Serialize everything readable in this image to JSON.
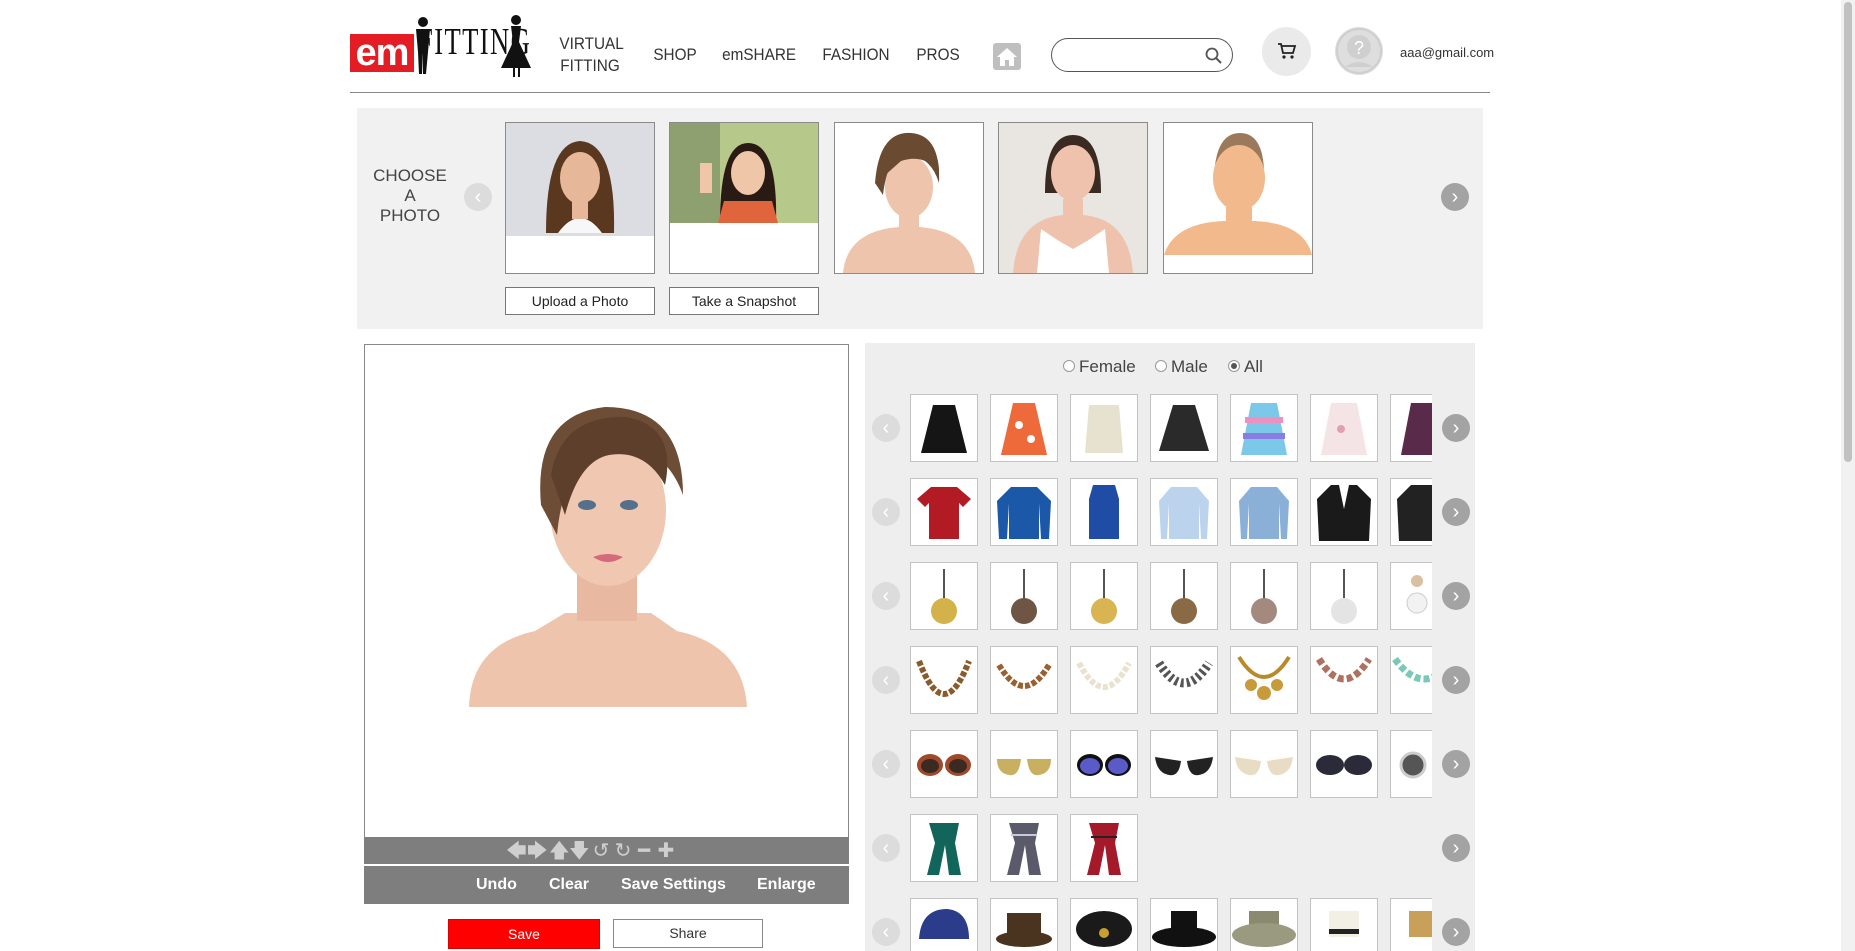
{
  "header": {
    "logo_em": "em",
    "logo_fitting": "FITTING",
    "nav": [
      {
        "label_line1": "VIRTUAL",
        "label_line2": "FITTING"
      },
      {
        "label": "SHOP"
      },
      {
        "label": "emSHARE"
      },
      {
        "label": "FASHION"
      },
      {
        "label": "PROS"
      }
    ],
    "search_placeholder": "",
    "user_email": "aaa@gmail.com"
  },
  "choose_photo": {
    "label_lines": [
      "CHOOSE",
      "A",
      "PHOTO"
    ],
    "upload_label": "Upload a Photo",
    "snapshot_label": "Take a Snapshot"
  },
  "editor": {
    "undo": "Undo",
    "clear": "Clear",
    "save_settings": "Save Settings",
    "enlarge": "Enlarge",
    "save": "Save",
    "share": "Share"
  },
  "filter": {
    "options": [
      "Female",
      "Male",
      "All"
    ],
    "selected": "All"
  },
  "catalog": {
    "rows": [
      {
        "category": "skirts",
        "items": 7
      },
      {
        "category": "tops",
        "items": 7
      },
      {
        "category": "earrings",
        "items": 7
      },
      {
        "category": "necklaces",
        "items": 7
      },
      {
        "category": "sunglasses",
        "items": 7
      },
      {
        "category": "scarves",
        "items": 3
      },
      {
        "category": "hats",
        "items": 7
      }
    ]
  },
  "colors": {
    "brand_red": "#e41c23",
    "save_red": "#ff0000",
    "toolbar_gray": "#7e7e7e",
    "panel_gray": "#eeeeee"
  }
}
